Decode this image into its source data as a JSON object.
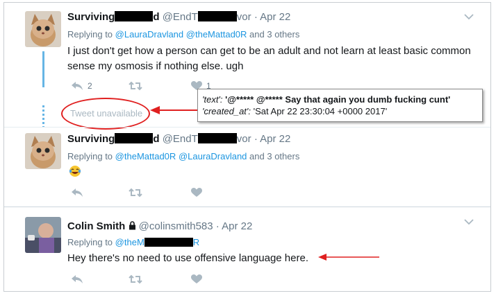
{
  "tweets": [
    {
      "name_start": "Surviving",
      "name_end": "d",
      "handle_start": "@EndT",
      "handle_end": "vor",
      "separator": "·",
      "date": "Apr 22",
      "replying_prefix": "Replying to",
      "mentions": [
        "@LauraDravland",
        "@theMattad0R"
      ],
      "others": "and 3 others",
      "text": "I just don't get how a person can get to be an adult and not learn at least basic common sense my osmosis if nothing else. ugh",
      "reply_count": "2",
      "like_count": "1"
    },
    {
      "name_start": "Surviving",
      "name_end": "d",
      "handle_start": "@EndT",
      "handle_end": "vor",
      "separator": "·",
      "date": "Apr 22",
      "replying_prefix": "Replying to",
      "mentions": [
        "@theMattad0R",
        "@LauraDravland"
      ],
      "others": "and 3 others",
      "emoji": "tears-of-joy"
    },
    {
      "name": "Colin Smith",
      "handle": "@colinsmith583",
      "separator": "·",
      "date": "Apr 22",
      "replying_prefix": "Replying to",
      "mention_start": "@theM",
      "mention_end": "R",
      "text": "Hey there's no need to use offensive language here."
    }
  ],
  "unavailable_label": "Tweet unavailable",
  "annotation": {
    "text_key": "'text':",
    "text_value": " '@***** @***** Say that again you dumb fucking cunt'",
    "created_key": "'created_at':",
    "created_value": " 'Sat Apr 22 23:30:04 +0000 2017'"
  },
  "colors": {
    "link": "#1b95e0",
    "muted": "#657786",
    "icon": "#aab8c2",
    "thread_line": "#66b5e5",
    "annotation_red": "#e02020"
  }
}
